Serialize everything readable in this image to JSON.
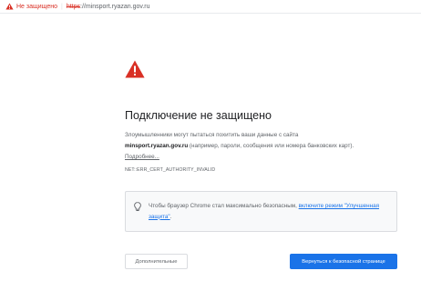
{
  "addressbar": {
    "security_label": "Не защищено",
    "separator": "|",
    "url_scheme": "https",
    "url_rest": "://minsport.ryazan.gov.ru",
    "warning_color": "#d93025",
    "icon": "warning-triangle-icon"
  },
  "interstitial": {
    "icon": "danger-triangle-icon",
    "icon_color": "#d93025",
    "title": "Подключение не защищено",
    "message_prefix": "Злоумышленники могут пытаться похитить ваши данные с сайта",
    "domain": "minsport.ryazan.gov.ru",
    "message_suffix": "(например, пароли, сообщения или номера банковских карт).",
    "details_link": "Подробнее...",
    "error_code": "NET::ERR_CERT_AUTHORITY_INVALID"
  },
  "safe_browsing": {
    "icon": "lightbulb-icon",
    "text": "Чтобы браузер Chrome стал максимально безопасным,",
    "link": "включите режим \"Улучшенная защита\"",
    "suffix": "."
  },
  "buttons": {
    "advanced": "Дополнительные",
    "back_to_safety": "Вернуться к безопасной странице",
    "primary_color": "#1a73e8"
  }
}
